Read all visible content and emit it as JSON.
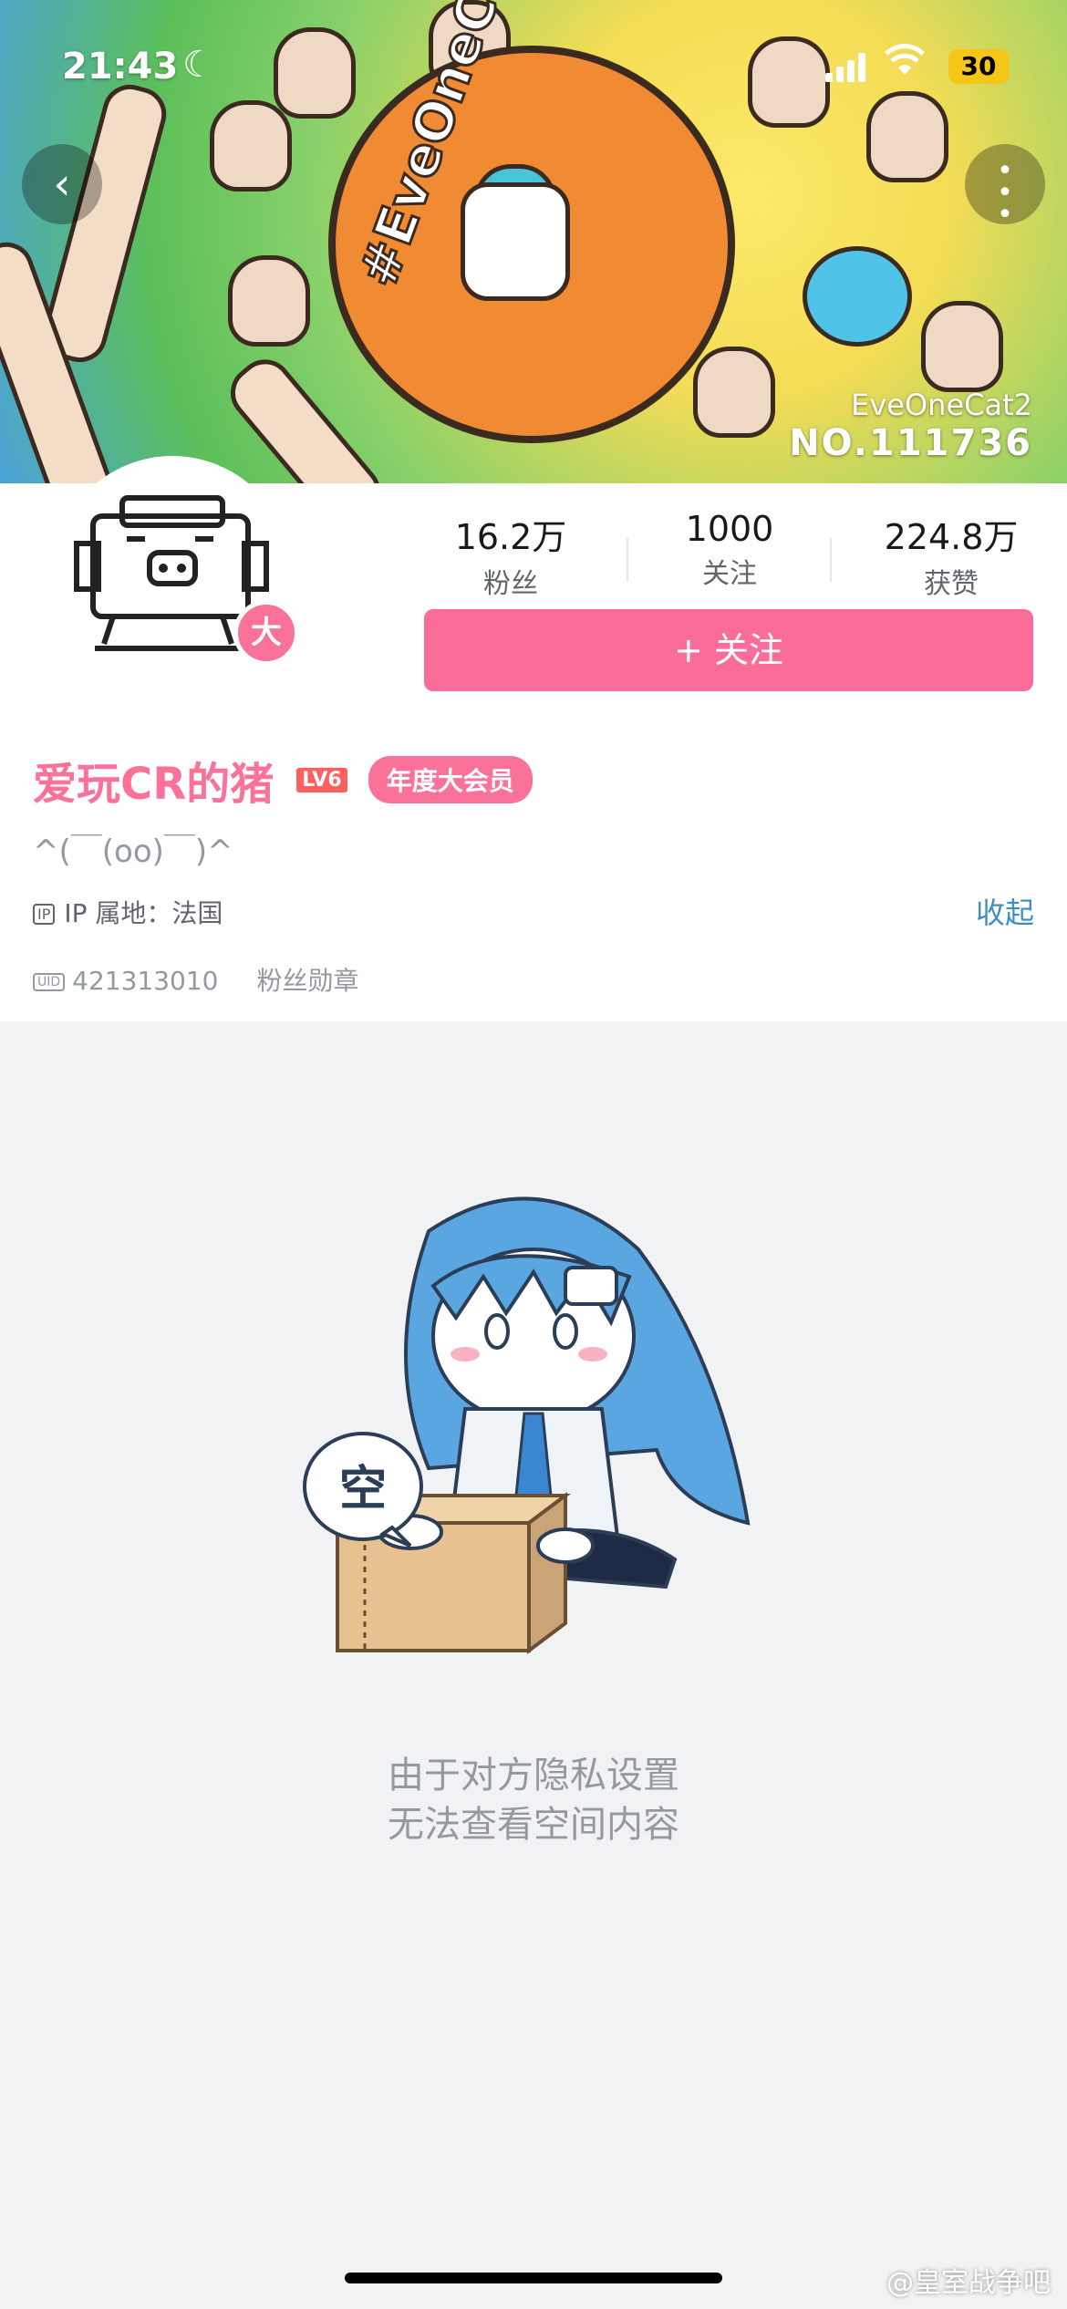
{
  "status_bar": {
    "time": "21:43",
    "battery": "30"
  },
  "banner": {
    "hashtag": "#EveOneCat",
    "tag_name": "EveOneCat2",
    "tag_number": "NO.111736"
  },
  "profile": {
    "avatar_badge": "大",
    "stats": [
      {
        "value": "16.2万",
        "label": "粉丝"
      },
      {
        "value": "1000",
        "label": "关注"
      },
      {
        "value": "224.8万",
        "label": "获赞"
      }
    ],
    "follow_label": "+ 关注",
    "username": "爱玩CR的猪",
    "level": "LV6",
    "vip_label": "年度大会员",
    "signature": "^(￣(oo)￣)^",
    "ip_icon": "IP",
    "ip_location": "IP 属地：法国",
    "collapse_label": "收起",
    "uid_icon": "UID",
    "uid": "421313010",
    "medal_label": "粉丝勋章"
  },
  "empty_state": {
    "bubble_text": "空",
    "line1": "由于对方隐私设置",
    "line2": "无法查看空间内容"
  },
  "watermark": "@皇室战争吧",
  "colors": {
    "brand_pink": "#fb7299",
    "follow_button": "#fb6d99",
    "link_blue": "#3d8fbf",
    "page_bg": "#f1f2f3"
  },
  "icons": [
    "back-icon",
    "more-icon",
    "moon-icon",
    "signal-icon",
    "wifi-icon",
    "battery-icon",
    "ip-icon",
    "uid-icon"
  ]
}
